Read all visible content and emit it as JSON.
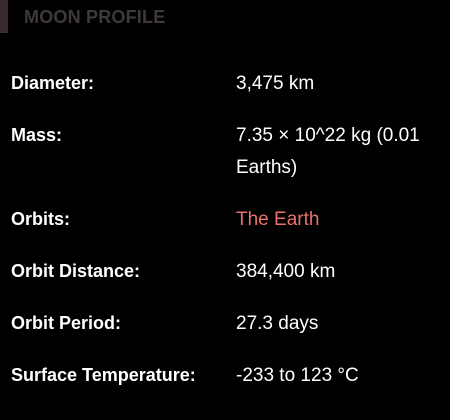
{
  "header": {
    "title": "MOON PROFILE",
    "accent_color": "#3a2c2c"
  },
  "facts": [
    {
      "label": "Diameter:",
      "value": "3,475 km"
    },
    {
      "label": "Mass:",
      "value": "7.35 × 10^22 kg (0.01 Earths)"
    },
    {
      "label": "Orbits:",
      "value": "The Earth",
      "link_color": "#e8726b"
    },
    {
      "label": "Orbit Distance:",
      "value": "384,400 km"
    },
    {
      "label": "Orbit Period:",
      "value": "27.3 days"
    },
    {
      "label": "Surface Temperature:",
      "value": "-233 to 123 °C"
    }
  ]
}
